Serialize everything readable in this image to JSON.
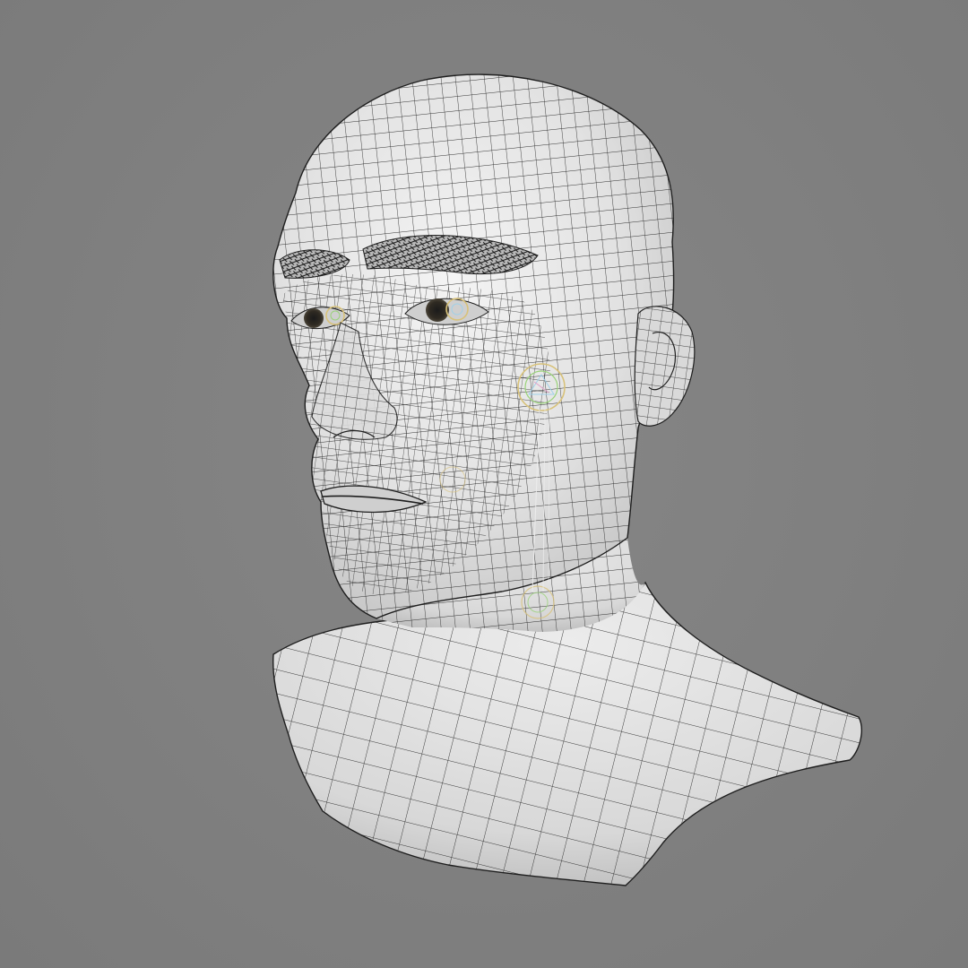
{
  "scene": {
    "subject": "head-bust-wireframe",
    "background_color": "#818181",
    "surface_color": "#e6e6e6",
    "wire_color": "#1e1e1e",
    "shadow_color": "#b9b9b9",
    "gizmo_colors": [
      "#d8c27a",
      "#9ad27a",
      "#9fd0e8",
      "#e0a0c8"
    ],
    "display_mode": "wireframe-on-shaded"
  }
}
